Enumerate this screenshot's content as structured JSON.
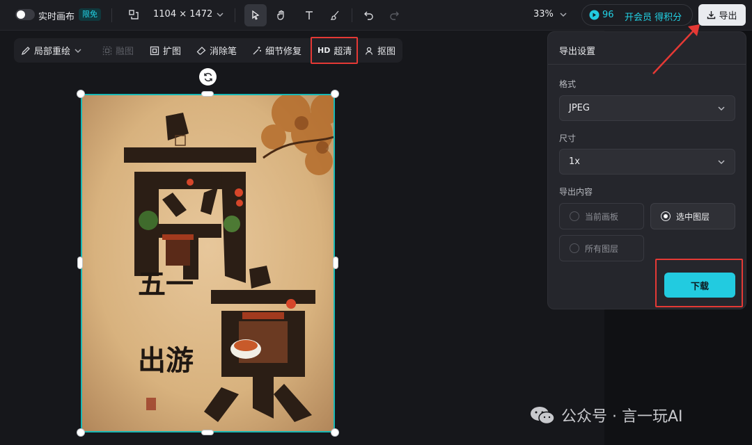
{
  "topbar": {
    "realtime_label": "实时画布",
    "realtime_badge": "限免",
    "canvas_size": "1104 × 1472",
    "zoom": "33%",
    "points": "96",
    "member_text": "开会员 得积分",
    "export_label": "导出"
  },
  "edit_toolbar": {
    "inpaint": "局部重绘",
    "fuse": "融图",
    "expand": "扩图",
    "eraser": "消除笔",
    "detail_fix": "细节修复",
    "hd_badge": "HD",
    "hd_label": "超清",
    "cutout": "抠图"
  },
  "poster": {
    "title_char_1": "南",
    "title_char_2": "京",
    "subtitle_1": "五一",
    "subtitle_2": "出游"
  },
  "export_panel": {
    "title": "导出设置",
    "format_label": "格式",
    "format_value": "JPEG",
    "size_label": "尺寸",
    "size_value": "1x",
    "content_label": "导出内容",
    "options": [
      "当前画板",
      "选中图层",
      "所有图层"
    ],
    "selected_option": "选中图层",
    "download_label": "下载"
  },
  "watermark": "公众号 · 言一玩AI",
  "colors": {
    "accent": "#22cbe0",
    "selection": "#18b8b5",
    "highlight_box": "#e53935"
  }
}
